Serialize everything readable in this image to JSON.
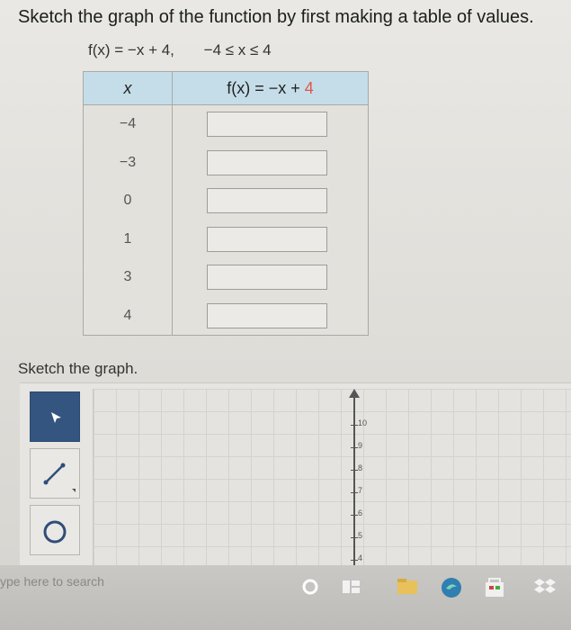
{
  "instruction": "Sketch the graph of the function by first making a table of values.",
  "function_def": "f(x) = −x + 4,",
  "domain": "−4 ≤ x ≤ 4",
  "table": {
    "header_x": "x",
    "header_f_prefix": "f(x) = −x +",
    "header_f_const": "4",
    "rows": [
      {
        "x": "−4",
        "value": ""
      },
      {
        "x": "−3",
        "value": ""
      },
      {
        "x": "0",
        "value": ""
      },
      {
        "x": "1",
        "value": ""
      },
      {
        "x": "3",
        "value": ""
      },
      {
        "x": "4",
        "value": ""
      }
    ]
  },
  "sketch_label": "Sketch the graph.",
  "graph": {
    "y_ticks": [
      "10",
      "9",
      "8",
      "7",
      "6",
      "5",
      "4"
    ]
  },
  "tools": [
    "select-arrow-icon",
    "line-tool-icon",
    "circle-tool-icon"
  ],
  "taskbar": {
    "search_placeholder": "ype here to search"
  },
  "colors": {
    "table_header_bg": "#c5dde9",
    "selected_tool_bg": "#33557f",
    "accent_red": "#e0564a"
  }
}
